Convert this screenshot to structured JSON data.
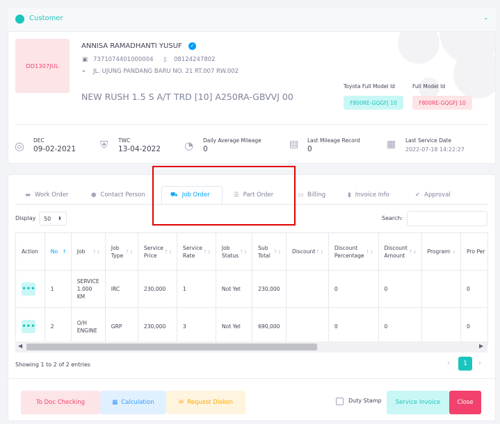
{
  "customer": {
    "section_title": "Customer",
    "plate": "DD1307JUL",
    "name": "ANNISA RAMADHANTI YUSUF",
    "id_number": "7371074401000004",
    "phone": "08124247802",
    "address": "JL. UJUNG PANDANG BARU NO. 21 RT.007 RW.002",
    "vehicle": "NEW RUSH 1.5 S A/T TRD [10] A250RA-GBVVJ 00",
    "toyota_model_label": "Toyota Full Model Id",
    "toyota_model_value": "F800RE-GQGFJ 10",
    "full_model_label": "Full Model Id",
    "full_model_value": "F800RE-GQGFJ 10"
  },
  "stats": [
    {
      "label": "DEC",
      "value": "09-02-2021",
      "icon": "globe-icon"
    },
    {
      "label": "TWC",
      "value": "13-04-2022",
      "icon": "shield-icon"
    },
    {
      "label": "Daily Average Mileage",
      "value": "0",
      "icon": "speedometer-icon"
    },
    {
      "label": "Last Mileage Record",
      "value": "0",
      "icon": "document-icon"
    },
    {
      "label": "Last Service Date",
      "value": "2022-07-18 14:22:27",
      "icon": "calendar-icon"
    }
  ],
  "tabs": [
    {
      "label": "Work Order",
      "icon": "folder-icon"
    },
    {
      "label": "Contact Person",
      "icon": "user-icon"
    },
    {
      "label": "Job Order",
      "icon": "car-icon",
      "active": true
    },
    {
      "label": "Part Order",
      "icon": "list-icon"
    },
    {
      "label": "Billing",
      "icon": "wallet-icon"
    },
    {
      "label": "Invoice Info",
      "icon": "invoice-icon"
    },
    {
      "label": "Approval",
      "icon": "check-icon"
    }
  ],
  "table_controls": {
    "display_label": "Display",
    "display_value": "50",
    "search_label": "Search:",
    "search_value": ""
  },
  "table": {
    "columns": [
      "Action",
      "No",
      "Job",
      "Job Type",
      "Service Price",
      "Service Rate",
      "Job Status",
      "Sub Total",
      "Discount",
      "Discount Percentage",
      "Discount Amount",
      "Program",
      "Pro Per"
    ],
    "rows": [
      {
        "no": "1",
        "job": "SERVICE 1.000 KM",
        "job_type": "IRC",
        "service_price": "230,000",
        "service_rate": "1",
        "job_status": "Not Yet",
        "sub_total": "230,000",
        "discount": "",
        "discount_percentage": "0",
        "discount_amount": "0",
        "program": "",
        "pro_per": "0"
      },
      {
        "no": "2",
        "job": "O/H ENGINE",
        "job_type": "GRP",
        "service_price": "230,000",
        "service_rate": "3",
        "job_status": "Not Yet",
        "sub_total": "690,000",
        "discount": "",
        "discount_percentage": "0",
        "discount_amount": "0",
        "program": "",
        "pro_per": "0"
      }
    ]
  },
  "pagination": {
    "info": "Showing 1 to 2 of 2 entries",
    "current_page": "1"
  },
  "footer": {
    "doc_checking": "To Doc Checking",
    "calculation": "Calculation",
    "request_diskon": "Request Diskon",
    "duty_stamp": "Duty Stamp",
    "service_invoice": "Service Invoice",
    "close": "Close"
  },
  "colors": {
    "accent": "#1bc5bd",
    "primary": "#009ef7",
    "danger": "#f1416c",
    "highlight_box": "#e00000"
  }
}
